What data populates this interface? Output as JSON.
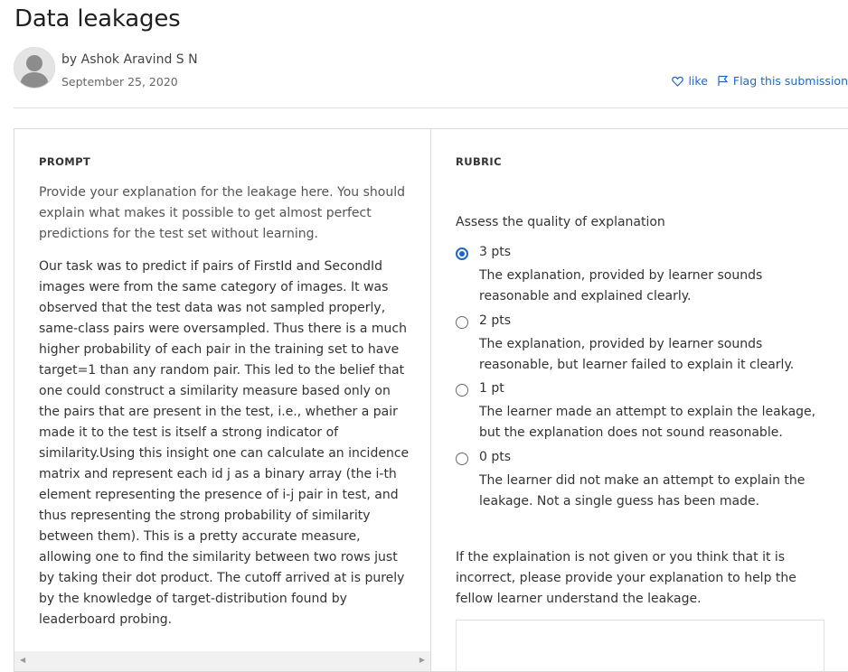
{
  "page": {
    "title": "Data leakages",
    "author": "by Ashok Aravind S N",
    "date": "September 25, 2020",
    "actions": {
      "like": "like",
      "flag": "Flag this submission"
    }
  },
  "prompt": {
    "heading": "PROMPT",
    "instructions": "Provide your explanation for the leakage here. You should explain what makes it possible to get almost perfect predictions for the test set without learning.",
    "answer": "Our task was to predict if pairs of FirstId and SecondId images were from the same category of images. It was observed that the test data was not sampled properly, same-class pairs were oversampled. Thus there is a much higher probability of each pair in the training set to have target=1 than any random pair. This led to the belief that one could construct a similarity measure based only on the pairs that are present in the test, i.e., whether a pair made it to the test is itself a strong indicator of similarity.Using this insight one can calculate an incidence matrix and represent each id j as a binary array (the i-th element representing the presence of i-j pair in test, and thus representing the strong probability of similarity between them). This is a pretty accurate measure, allowing one to find the similarity between two rows just by taking their dot product. The cutoff arrived at is purely by the knowledge of target-distribution found by leaderboard probing."
  },
  "rubric": {
    "heading": "RUBRIC",
    "criterion": "Assess the quality of explanation",
    "options": [
      {
        "points": "3 pts",
        "description": "The explanation, provided by learner sounds reasonable and explained clearly.",
        "selected": true
      },
      {
        "points": "2 pts",
        "description": "The explanation, provided by learner sounds reasonable, but learner failed to explain it clearly.",
        "selected": false
      },
      {
        "points": "1 pt",
        "description": "The learner made an attempt to explain the leakage, but the explanation does not sound reasonable.",
        "selected": false
      },
      {
        "points": "0 pts",
        "description": "The learner did not make an attempt to explain the leakage. Not a single guess has been made.",
        "selected": false
      }
    ],
    "note": "If the explaination is not given or you think that it is incorrect, please provide your explanation to help the fellow learner understand the leakage."
  },
  "icons": {
    "avatar": "user-silhouette-icon",
    "like": "heart-icon",
    "flag": "flag-icon"
  },
  "colors": {
    "link": "#1f67c7",
    "radio_selected": "#1f67c7",
    "border": "#d9d9d9"
  }
}
